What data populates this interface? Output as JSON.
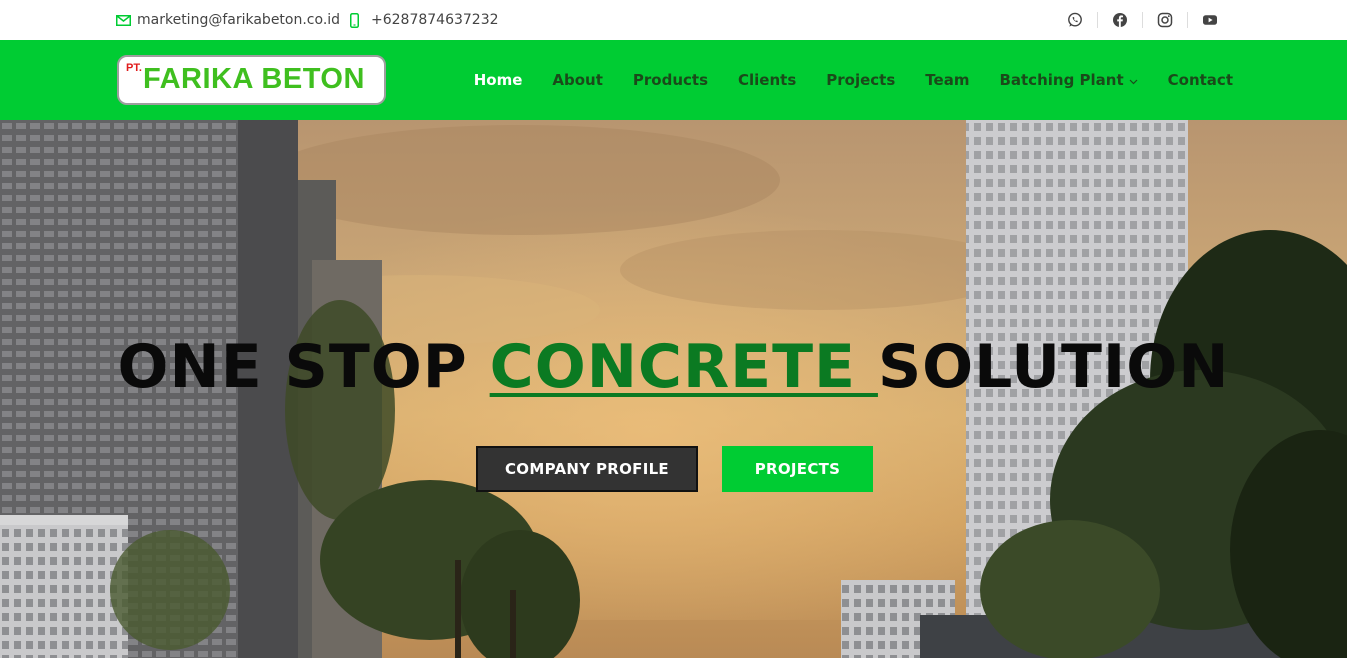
{
  "topbar": {
    "email": "marketing@farikabeton.co.id",
    "phone": "+6287874637232",
    "socials": [
      {
        "icon": "whatsapp-icon"
      },
      {
        "icon": "facebook-icon"
      },
      {
        "icon": "instagram-icon"
      },
      {
        "icon": "youtube-icon"
      }
    ]
  },
  "header": {
    "logo": {
      "prefix": "PT.",
      "name": "FARIKA BETON"
    },
    "nav": [
      {
        "label": "Home",
        "active": true
      },
      {
        "label": "About"
      },
      {
        "label": "Products"
      },
      {
        "label": "Clients"
      },
      {
        "label": "Projects"
      },
      {
        "label": "Team"
      },
      {
        "label": "Batching Plant",
        "dropdown": true
      },
      {
        "label": "Contact"
      }
    ]
  },
  "hero": {
    "headline_pre": "ONE STOP ",
    "headline_accent": "CONCRETE ",
    "headline_post": "SOLUTION",
    "buttons": {
      "company_profile": "COMPANY PROFILE",
      "projects": "PROJECTS"
    }
  },
  "colors": {
    "brand_green": "#00cc33",
    "accent_green": "#0b7a22",
    "logo_red": "#e01b1b",
    "logo_green": "#3fbf1f",
    "dark_button": "#333333"
  }
}
